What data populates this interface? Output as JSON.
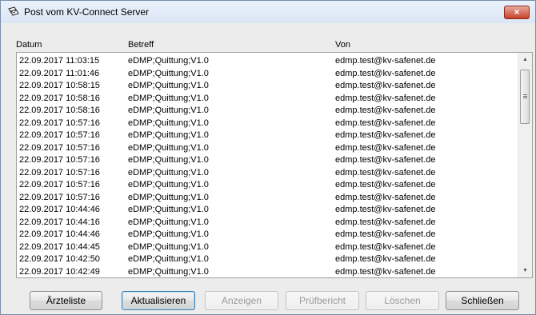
{
  "window": {
    "title": "Post vom KV-Connect Server",
    "close_label": "×"
  },
  "columns": {
    "date": "Datum",
    "subject": "Betreff",
    "from": "Von"
  },
  "rows": [
    {
      "date": "22.09.2017 11:03:15",
      "subject": "eDMP;Quittung;V1.0",
      "from": "edmp.test@kv-safenet.de"
    },
    {
      "date": "22.09.2017 11:01:46",
      "subject": "eDMP;Quittung;V1.0",
      "from": "edmp.test@kv-safenet.de"
    },
    {
      "date": "22.09.2017 10:58:15",
      "subject": "eDMP;Quittung;V1.0",
      "from": "edmp.test@kv-safenet.de"
    },
    {
      "date": "22.09.2017 10:58:16",
      "subject": "eDMP;Quittung;V1.0",
      "from": "edmp.test@kv-safenet.de"
    },
    {
      "date": "22.09.2017 10:58:16",
      "subject": "eDMP;Quittung;V1.0",
      "from": "edmp.test@kv-safenet.de"
    },
    {
      "date": "22.09.2017 10:57:16",
      "subject": "eDMP;Quittung;V1.0",
      "from": "edmp.test@kv-safenet.de"
    },
    {
      "date": "22.09.2017 10:57:16",
      "subject": "eDMP;Quittung;V1.0",
      "from": "edmp.test@kv-safenet.de"
    },
    {
      "date": "22.09.2017 10:57:16",
      "subject": "eDMP;Quittung;V1.0",
      "from": "edmp.test@kv-safenet.de"
    },
    {
      "date": "22.09.2017 10:57:16",
      "subject": "eDMP;Quittung;V1.0",
      "from": "edmp.test@kv-safenet.de"
    },
    {
      "date": "22.09.2017 10:57:16",
      "subject": "eDMP;Quittung;V1.0",
      "from": "edmp.test@kv-safenet.de"
    },
    {
      "date": "22.09.2017 10:57:16",
      "subject": "eDMP;Quittung;V1.0",
      "from": "edmp.test@kv-safenet.de"
    },
    {
      "date": "22.09.2017 10:57:16",
      "subject": "eDMP;Quittung;V1.0",
      "from": "edmp.test@kv-safenet.de"
    },
    {
      "date": "22.09.2017 10:44:46",
      "subject": "eDMP;Quittung;V1.0",
      "from": "edmp.test@kv-safenet.de"
    },
    {
      "date": "22.09.2017 10:44:16",
      "subject": "eDMP;Quittung;V1.0",
      "from": "edmp.test@kv-safenet.de"
    },
    {
      "date": "22.09.2017 10:44:46",
      "subject": "eDMP;Quittung;V1.0",
      "from": "edmp.test@kv-safenet.de"
    },
    {
      "date": "22.09.2017 10:44:45",
      "subject": "eDMP;Quittung;V1.0",
      "from": "edmp.test@kv-safenet.de"
    },
    {
      "date": "22.09.2017 10:42:50",
      "subject": "eDMP;Quittung;V1.0",
      "from": "edmp.test@kv-safenet.de"
    },
    {
      "date": "22.09.2017 10:42:49",
      "subject": "eDMP;Quittung;V1.0",
      "from": "edmp.test@kv-safenet.de"
    }
  ],
  "buttons": {
    "doctors": "Ärzteliste",
    "refresh": "Aktualisieren",
    "show": "Anzeigen",
    "report": "Prüfbericht",
    "delete": "Löschen",
    "close": "Schließen"
  },
  "icons": {
    "title": "envelopes-icon",
    "scroll_up": "scroll-up-arrow-icon",
    "scroll_down": "scroll-down-arrow-icon"
  }
}
